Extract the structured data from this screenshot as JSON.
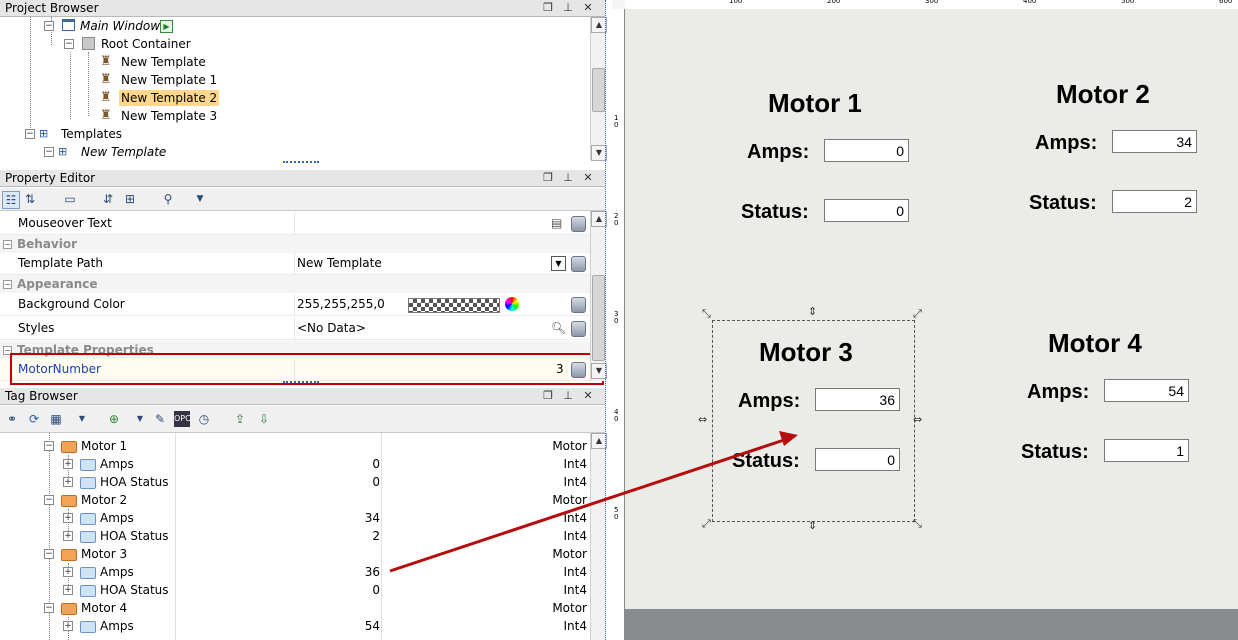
{
  "project_browser": {
    "title": "Project Browser",
    "items": [
      {
        "label": "Main Window"
      },
      {
        "label": "Root Container"
      },
      {
        "label": "New Template"
      },
      {
        "label": "New Template 1"
      },
      {
        "label": "New Template 2"
      },
      {
        "label": "New Template 3"
      },
      {
        "label": "Templates"
      },
      {
        "label": "New Template"
      }
    ]
  },
  "property_editor": {
    "title": "Property Editor",
    "rows": {
      "mouseover": {
        "name": "Mouseover Text",
        "value": ""
      },
      "behavior": "Behavior",
      "template_path": {
        "name": "Template Path",
        "value": "New Template"
      },
      "appearance": "Appearance",
      "background_color": {
        "name": "Background Color",
        "value": "255,255,255,0"
      },
      "styles": {
        "name": "Styles",
        "value": "<No Data>"
      },
      "template_properties": "Template Properties",
      "motor_number": {
        "name": "MotorNumber",
        "value": "3"
      }
    },
    "colors": {
      "highlight_border": "#c00000",
      "link_text": "#1a3fb0"
    }
  },
  "tag_browser": {
    "title": "Tag Browser",
    "rows": [
      {
        "label": "Motor 1",
        "value": "",
        "type": "Motor"
      },
      {
        "label": "Amps",
        "value": "0",
        "type": "Int4"
      },
      {
        "label": "HOA Status",
        "value": "0",
        "type": "Int4"
      },
      {
        "label": "Motor 2",
        "value": "",
        "type": "Motor"
      },
      {
        "label": "Amps",
        "value": "34",
        "type": "Int4"
      },
      {
        "label": "HOA Status",
        "value": "2",
        "type": "Int4"
      },
      {
        "label": "Motor 3",
        "value": "",
        "type": "Motor"
      },
      {
        "label": "Amps",
        "value": "36",
        "type": "Int4"
      },
      {
        "label": "HOA Status",
        "value": "0",
        "type": "Int4"
      },
      {
        "label": "Motor 4",
        "value": "",
        "type": "Motor"
      },
      {
        "label": "Amps",
        "value": "54",
        "type": "Int4"
      }
    ]
  },
  "canvas": {
    "ruler_ticks": [
      "100",
      "200",
      "300",
      "400",
      "500",
      "600"
    ],
    "ruler_v_ticks": [
      "1\n0",
      "2\n0",
      "3\n0",
      "4\n0",
      "5\n0"
    ],
    "amps_label": "Amps:",
    "status_label": "Status:",
    "motors": [
      {
        "title": "Motor 1",
        "amps": "0",
        "status": "0"
      },
      {
        "title": "Motor 2",
        "amps": "34",
        "status": "2"
      },
      {
        "title": "Motor 3",
        "amps": "36",
        "status": "0"
      },
      {
        "title": "Motor 4",
        "amps": "54",
        "status": "1"
      }
    ],
    "arrow_color": "#b50d0d"
  },
  "icons": [
    "folder-tree-icon",
    "window-icon",
    "container-icon",
    "template-icon",
    "tag-folder-icon",
    "tag-icon",
    "binding-db-icon",
    "color-wheel-icon"
  ]
}
